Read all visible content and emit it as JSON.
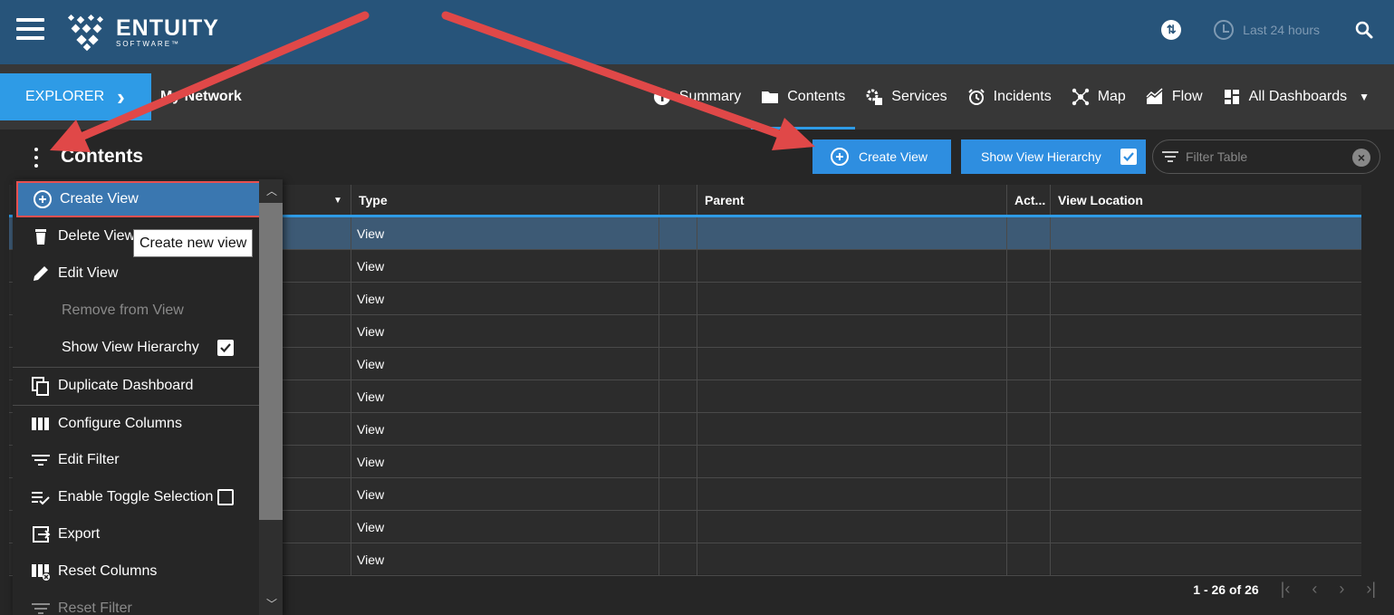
{
  "app": {
    "logo_main": "ENTUITY",
    "logo_sub": "SOFTWARE™"
  },
  "topbar": {
    "time_range": "Last 24 hours"
  },
  "nav": {
    "explorer_label": "EXPLORER",
    "breadcrumb": "My Network",
    "tabs": [
      {
        "label": "Summary",
        "icon": "info-icon"
      },
      {
        "label": "Contents",
        "icon": "folder-icon",
        "active": true
      },
      {
        "label": "Services",
        "icon": "services-gear-icon"
      },
      {
        "label": "Incidents",
        "icon": "alarm-clock-icon"
      },
      {
        "label": "Map",
        "icon": "map-nodes-icon"
      },
      {
        "label": "Flow",
        "icon": "flow-chart-icon"
      },
      {
        "label": "All Dashboards",
        "icon": "dashboard-grid-icon"
      }
    ]
  },
  "content": {
    "title": "Contents",
    "create_view_label": "Create View",
    "show_hierarchy_label": "Show View Hierarchy",
    "show_hierarchy_checked": true,
    "filter_placeholder": "Filter Table"
  },
  "table": {
    "columns": [
      "Type",
      "",
      "Parent",
      "Act...",
      "View Location"
    ],
    "rows": [
      {
        "type": "View",
        "selected": true
      },
      {
        "type": "View"
      },
      {
        "type": "View"
      },
      {
        "type": "View"
      },
      {
        "type": "View"
      },
      {
        "type": "View"
      },
      {
        "type": "View"
      },
      {
        "type": "View"
      },
      {
        "type": "View"
      },
      {
        "type": "View"
      },
      {
        "type": "View"
      }
    ]
  },
  "pager": {
    "range_text": "1 - 26 of 26"
  },
  "menu": {
    "items": [
      {
        "label": "Create View",
        "icon": "plus-circle-icon",
        "highlight": true
      },
      {
        "label": "Delete View",
        "icon": "trash-icon"
      },
      {
        "label": "Edit View",
        "icon": "pencil-icon"
      },
      {
        "label": "Remove from View",
        "disabled": true
      },
      {
        "label": "Show View Hierarchy",
        "checked": true
      },
      {
        "label": "Duplicate Dashboard",
        "icon": "copy-icon"
      },
      {
        "label": "Configure Columns",
        "icon": "columns-icon"
      },
      {
        "label": "Edit Filter",
        "icon": "filter-icon"
      },
      {
        "label": "Enable Toggle Selection",
        "icon": "toggle-select-icon",
        "checked": false
      },
      {
        "label": "Export",
        "icon": "export-icon"
      },
      {
        "label": "Reset Columns",
        "icon": "reset-columns-icon"
      },
      {
        "label": "Reset Filter",
        "icon": "reset-filter-icon",
        "disabled": true
      }
    ]
  },
  "tooltip": {
    "text": "Create new view"
  },
  "colors": {
    "topbar": "#27547a",
    "accent": "#2e9be6",
    "annotation_arrow": "#e04848"
  }
}
